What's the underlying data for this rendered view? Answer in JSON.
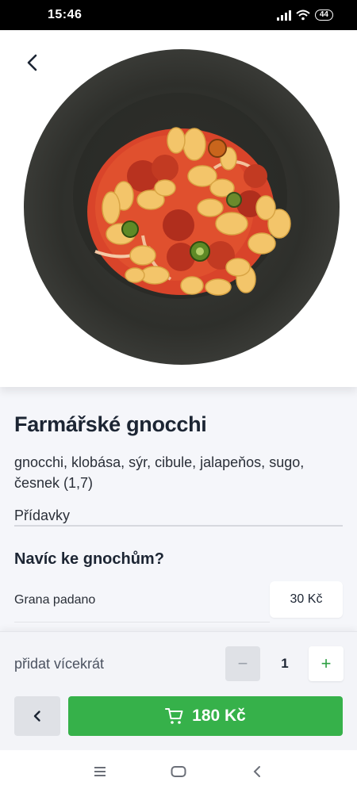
{
  "status_bar": {
    "time": "15:46",
    "battery": "44"
  },
  "dish": {
    "title": "Farmářské gnocchi",
    "description": "gnocchi, klobása, sýr, cibule, jalapeňos, sugo, česnek (1,7)"
  },
  "extras": {
    "label": "Přídavky",
    "section_title": "Navíc ke gnochům?",
    "options": [
      {
        "name": "Grana padano",
        "price": "30 Kč"
      }
    ]
  },
  "order": {
    "repeat_label": "přidat vícekrát",
    "quantity": "1",
    "minus_symbol": "−",
    "plus_symbol": "+",
    "add_price": "180 Kč"
  },
  "colors": {
    "accent": "#36b14a",
    "background": "#f5f6fa"
  },
  "icons": {
    "back": "chevron-left-icon",
    "cart": "cart-icon",
    "nav_menu": "menu-icon",
    "nav_home": "home-icon",
    "nav_back": "back-icon"
  }
}
